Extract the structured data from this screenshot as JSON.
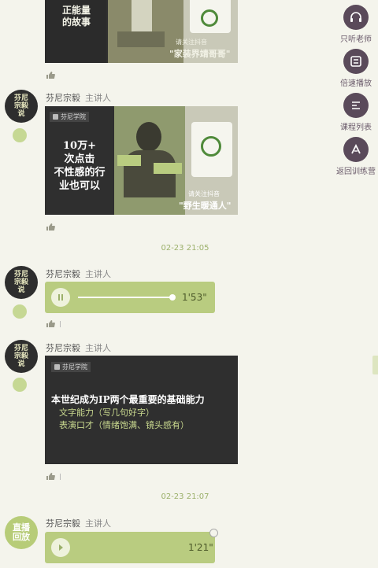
{
  "messages": [
    {
      "type": "image",
      "left_lines": [
        "正能量",
        "的故事"
      ],
      "follow_text": "请关注抖音",
      "account": "家装界靖哥哥"
    },
    {
      "type": "image",
      "sender": "芬尼宗毅",
      "role": "主讲人",
      "logo": "芬尼学院",
      "left_lines": [
        "10万+",
        "次点击",
        "不性感的行",
        "业也可以"
      ],
      "follow_text": "请关注抖音",
      "account": "野生暖通人"
    },
    {
      "type": "time",
      "text": "02-23 21:05"
    },
    {
      "type": "audio",
      "sender": "芬尼宗毅",
      "role": "主讲人",
      "duration": "1'53\"",
      "progress": 1.0
    },
    {
      "type": "image",
      "sender": "芬尼宗毅",
      "role": "主讲人",
      "logo": "芬尼学院",
      "headline": "本世纪成为IP两个最重要的基础能力",
      "line1": "文字能力（写几句好字）",
      "line2": "表演口才（情绪饱满、镜头感有）"
    },
    {
      "type": "time",
      "text": "02-23 21:07"
    },
    {
      "type": "audio",
      "sender": "芬尼宗毅",
      "role": "主讲人",
      "duration": "1'21\"",
      "avatar_text": [
        "直播",
        "回放"
      ]
    }
  ],
  "avatar_text": [
    "芬尼",
    "宗毅",
    "说"
  ],
  "sidebar": [
    {
      "label": "只听老师",
      "icon": "headphones-icon"
    },
    {
      "label": "倍速播放",
      "icon": "speed-icon"
    },
    {
      "label": "课程列表",
      "icon": "list-icon"
    },
    {
      "label": "返回训练营",
      "icon": "back-icon"
    }
  ],
  "colors": {
    "background": "#f4f4ec",
    "bubble": "#b9cc80",
    "sidebar_icon": "#5a4a5a",
    "timestamp": "#9bb06a"
  }
}
